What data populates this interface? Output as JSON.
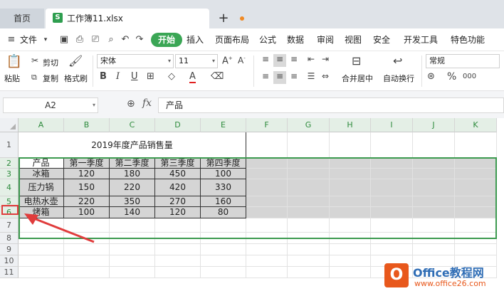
{
  "tabs": {
    "home": "首页",
    "document": "工作簿11.xlsx",
    "new_tab": "+"
  },
  "menu": {
    "file": "文件",
    "items": [
      "开始",
      "插入",
      "页面布局",
      "公式",
      "数据",
      "审阅",
      "视图",
      "安全",
      "开发工具",
      "特色功能"
    ]
  },
  "ribbon": {
    "paste": "粘贴",
    "cut": "剪切",
    "copy": "复制",
    "format_painter": "格式刷",
    "font_name": "宋体",
    "font_size": "11",
    "merge_center": "合并居中",
    "wrap_text": "自动换行",
    "number_format": "常规",
    "percent": "%",
    "thousands": "000"
  },
  "formula_bar": {
    "cell_ref": "A2",
    "fx": "fx",
    "content": "产品"
  },
  "columns": [
    "A",
    "B",
    "C",
    "D",
    "E",
    "F",
    "G",
    "H",
    "I",
    "J",
    "K"
  ],
  "rows": [
    "1",
    "2",
    "3",
    "4",
    "5",
    "6",
    "7",
    "8",
    "9",
    "10",
    "11"
  ],
  "sheet": {
    "title": "2019年度产品销售量",
    "headers": [
      "产品",
      "第一季度",
      "第二季度",
      "第三季度",
      "第四季度"
    ],
    "data": [
      [
        "冰箱",
        "120",
        "180",
        "450",
        "100"
      ],
      [
        "压力锅",
        "150",
        "220",
        "420",
        "330"
      ],
      [
        "电热水壶",
        "220",
        "350",
        "270",
        "160"
      ],
      [
        "烤箱",
        "100",
        "140",
        "120",
        "80"
      ]
    ]
  },
  "watermark": {
    "brand": "Office教程网",
    "url": "www.office26.com"
  },
  "colors": {
    "accent": "#3aa655",
    "selection_border": "#3c9a4f",
    "highlight": "#d5d5d5",
    "arrow": "#e03c3c",
    "logo": "#e8581c"
  }
}
